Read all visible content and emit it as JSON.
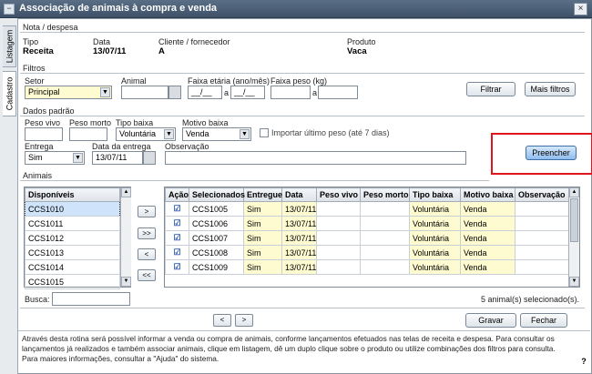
{
  "window": {
    "title": "Associação de animais à compra e venda",
    "close_glyph": "×"
  },
  "vertical_tabs": {
    "listagem": "Listagem",
    "cadastro": "Cadastro"
  },
  "nota": {
    "section": "Nota / despesa",
    "tipo_label": "Tipo",
    "tipo_value": "Receita",
    "data_label": "Data",
    "data_value": "13/07/11",
    "cliente_label": "Cliente / fornecedor",
    "cliente_value": "A",
    "produto_label": "Produto",
    "produto_value": "Vaca"
  },
  "filtros": {
    "section": "Filtros",
    "setor_label": "Setor",
    "setor_value": "Principal",
    "animal_label": "Animal",
    "faixa_etaria_label": "Faixa etária (ano/mês)",
    "faixa_etaria_from": "__/__",
    "faixa_etaria_to": "__/__",
    "faixa_peso_label": "Faixa peso (kg)",
    "a_sep": "a",
    "filtrar_button": "Filtrar",
    "mais_filtros_button": "Mais filtros"
  },
  "dados_padrao": {
    "section": "Dados padrão",
    "peso_vivo_label": "Peso vivo",
    "peso_morto_label": "Peso morto",
    "tipo_baixa_label": "Tipo baixa",
    "tipo_baixa_value": "Voluntária",
    "motivo_baixa_label": "Motivo baixa",
    "motivo_baixa_value": "Venda",
    "importar_label": "Importar último peso (até 7 dias)",
    "entrega_label": "Entrega",
    "entrega_value": "Sim",
    "data_entrega_label": "Data da entrega",
    "data_entrega_value": "13/07/11",
    "observacao_label": "Observação",
    "preencher_button": "Preencher"
  },
  "animais": {
    "section": "Animais",
    "disponiveis_header": "Disponíveis",
    "disponiveis": [
      "CCS1010",
      "CCS1011",
      "CCS1012",
      "CCS1013",
      "CCS1014",
      "CCS1015"
    ],
    "move_buttons": [
      ">",
      ">>",
      "<",
      "<<"
    ],
    "busca_label": "Busca:",
    "columns": [
      "Ação",
      "Selecionados",
      "Entregue",
      "Data",
      "Peso vivo",
      "Peso morto",
      "Tipo baixa",
      "Motivo baixa",
      "Observação"
    ],
    "rows": [
      {
        "selecionado": "CCS1005",
        "entregue": "Sim",
        "data": "13/07/11",
        "tipo_baixa": "Voluntária",
        "motivo": "Venda"
      },
      {
        "selecionado": "CCS1006",
        "entregue": "Sim",
        "data": "13/07/11",
        "tipo_baixa": "Voluntária",
        "motivo": "Venda"
      },
      {
        "selecionado": "CCS1007",
        "entregue": "Sim",
        "data": "13/07/11",
        "tipo_baixa": "Voluntária",
        "motivo": "Venda"
      },
      {
        "selecionado": "CCS1008",
        "entregue": "Sim",
        "data": "13/07/11",
        "tipo_baixa": "Voluntária",
        "motivo": "Venda"
      },
      {
        "selecionado": "CCS1009",
        "entregue": "Sim",
        "data": "13/07/11",
        "tipo_baixa": "Voluntária",
        "motivo": "Venda"
      }
    ],
    "count_text": "5 animal(s) selecionado(s)."
  },
  "footer": {
    "prev": "<",
    "next": ">",
    "gravar_button": "Gravar",
    "fechar_button": "Fechar",
    "help_text": "Através desta rotina será possível informar a venda ou compra de animais, conforme lançamentos efetuados nas telas de receita e despesa. Para consultar os lançamentos já realizados e também associar animais, clique em listagem, dê um duplo clique sobre o produto ou utilize combinações dos filtros para consulta. Para maiores informações, consultar a \"Ajuda\" do sistema.",
    "help_icon": "?"
  },
  "colors": {
    "highlight": "#e0141c",
    "input_yellow": "#fefbd0",
    "title_bar": "#4a5d73"
  }
}
